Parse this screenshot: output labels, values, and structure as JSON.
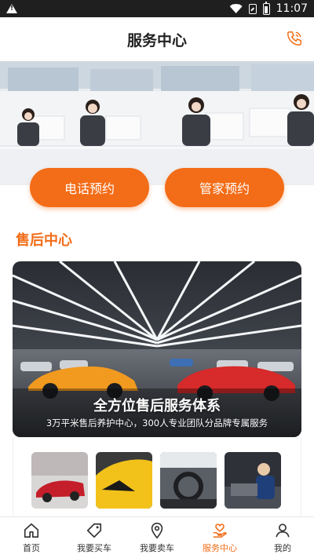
{
  "status_bar": {
    "time": "11:07",
    "icons": [
      "warning-icon",
      "wifi-icon",
      "sim-icon",
      "battery-icon"
    ]
  },
  "header": {
    "title": "服务中心",
    "phone_icon": "phone-icon"
  },
  "actions": {
    "phone_booking": "电话预约",
    "butler_booking": "管家预约"
  },
  "section": {
    "title": "售后中心"
  },
  "feature": {
    "title": "全方位售后服务体系",
    "subtitle": "3万平米售后养护中心，300人专业团队分品牌专属服务"
  },
  "thumbnails": [
    {
      "name": "red-sports-car"
    },
    {
      "name": "yellow-car-hood"
    },
    {
      "name": "car-interior"
    },
    {
      "name": "mechanic-engine"
    }
  ],
  "bottom_nav": {
    "items": [
      {
        "label": "首页",
        "icon": "home-icon"
      },
      {
        "label": "我要买车",
        "icon": "tag-icon"
      },
      {
        "label": "我要卖车",
        "icon": "location-icon"
      },
      {
        "label": "服务中心",
        "icon": "heart-hand-icon",
        "active": true
      },
      {
        "label": "我的",
        "icon": "user-icon"
      }
    ]
  },
  "colors": {
    "accent": "#f36c17",
    "status_bar": "#1f1f1f"
  }
}
